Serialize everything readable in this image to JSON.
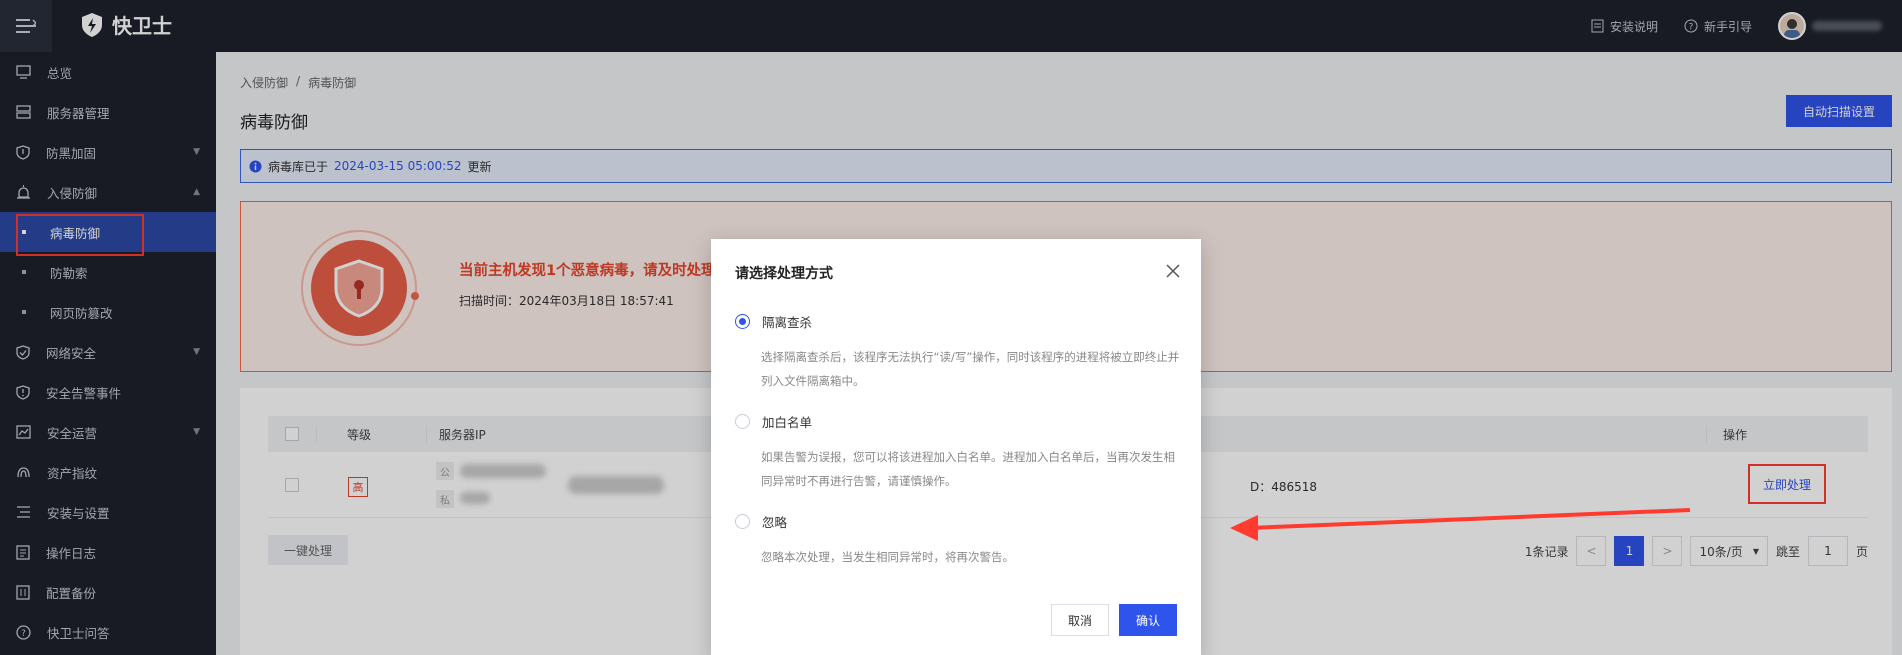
{
  "app": {
    "logo_text": "快卫士"
  },
  "topbar": {
    "install_doc": "安装说明",
    "guide": "新手引导"
  },
  "sidebar": {
    "items": [
      {
        "label": "总览",
        "icon": "monitor-icon"
      },
      {
        "label": "服务器管理",
        "icon": "server-icon"
      },
      {
        "label": "防黑加固",
        "icon": "shield-icon"
      },
      {
        "label": "入侵防御",
        "icon": "alarm-icon"
      },
      {
        "label": "病毒防御",
        "icon": "dot"
      },
      {
        "label": "防勒索",
        "icon": "dot"
      },
      {
        "label": "网页防篡改",
        "icon": "dot"
      },
      {
        "label": "网络安全",
        "icon": "shield-check-icon"
      },
      {
        "label": "安全告警事件",
        "icon": "shield-alert-icon"
      },
      {
        "label": "安全运营",
        "icon": "chart-icon"
      },
      {
        "label": "资产指纹",
        "icon": "fingerprint-icon"
      },
      {
        "label": "安装与设置",
        "icon": "settings-list-icon"
      },
      {
        "label": "操作日志",
        "icon": "log-icon"
      },
      {
        "label": "配置备份",
        "icon": "backup-icon"
      },
      {
        "label": "快卫士问答",
        "icon": "help-icon"
      }
    ]
  },
  "main": {
    "breadcrumb": [
      "入侵防御",
      "/",
      "病毒防御"
    ],
    "title": "病毒防御",
    "auto_scan_label": "自动扫描设置",
    "info": {
      "prefix": "病毒库已于",
      "date": "2024-03-15 05:00:52",
      "suffix": "更新"
    },
    "alert": {
      "title": "当前主机发现1个恶意病毒，请及时处理",
      "scan_time": "扫描时间：2024年03月18日 18:57:41"
    },
    "table": {
      "headers": {
        "level": "等级",
        "ip": "服务器IP",
        "action": "操作"
      },
      "row": {
        "level": "高",
        "ip_pub_tag": "公",
        "ip_priv_tag": "私",
        "pid": "D：486518",
        "action_label": "立即处理"
      }
    },
    "batch_label": "一键处理",
    "pager": {
      "total": "1条记录",
      "prev": "<",
      "current": "1",
      "next": ">",
      "page_size": "10条/页",
      "jump_label": "跳至",
      "jump_value": "1",
      "page_unit": "页"
    }
  },
  "modal": {
    "title": "请选择处理方式",
    "options": [
      {
        "label": "隔离查杀",
        "desc": "选择隔离查杀后，该程序无法执行“读/写”操作，同时该程序的进程将被立即终止并列入文件隔离箱中。",
        "selected": true
      },
      {
        "label": "加白名单",
        "desc": "如果告警为误报，您可以将该进程加入白名单。进程加入白名单后，当再次发生相同异常时不再进行告警，请谨慎操作。",
        "selected": false
      },
      {
        "label": "忽略",
        "desc": "忽略本次处理，当发生相同异常时，将再次警告。",
        "selected": false
      }
    ],
    "cancel_label": "取消",
    "ok_label": "确认"
  },
  "colors": {
    "accent": "#2f54eb",
    "danger": "#e8452d",
    "annotation": "#ff3b30"
  }
}
